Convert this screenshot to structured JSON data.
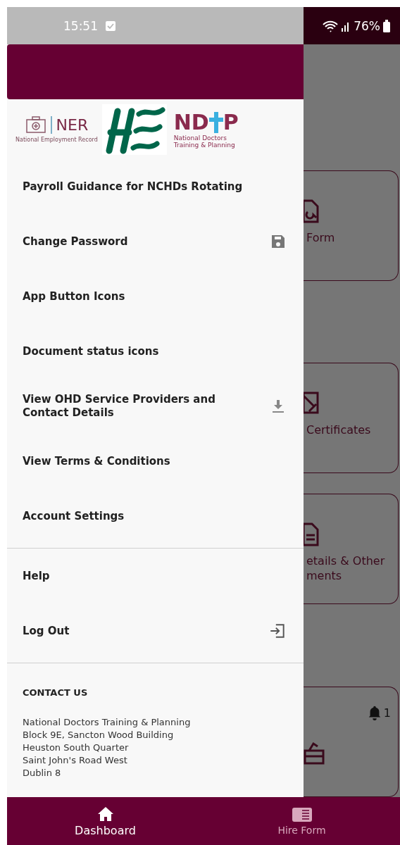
{
  "status_bar": {
    "time": "15:51",
    "battery": "76%"
  },
  "logos": {
    "ner": {
      "title": "NER",
      "subtitle": "National Employment Record"
    },
    "ndtp": {
      "left": "ND",
      "right": "P",
      "subtitle": "National Doctors Training & Planning"
    }
  },
  "menu_groups": [
    {
      "items": [
        {
          "label": "Payroll Guidance for NCHDs Rotating",
          "kind": "plain"
        },
        {
          "label": "Change Password",
          "kind": "save"
        },
        {
          "label": "App Button Icons",
          "kind": "plain"
        },
        {
          "label": "Document status icons",
          "kind": "plain"
        },
        {
          "label": "View OHD Service Providers and Contact Details",
          "kind": "download"
        },
        {
          "label": "View Terms & Conditions",
          "kind": "plain"
        },
        {
          "label": "Account Settings",
          "kind": "plain"
        }
      ]
    },
    {
      "items": [
        {
          "label": "Help",
          "kind": "plain"
        },
        {
          "label": "Log Out",
          "kind": "logout"
        }
      ]
    }
  ],
  "contact": {
    "heading": "CONTACT US",
    "lines": [
      "National Doctors Training & Planning",
      "Block 9E, Sancton Wood Building",
      "Heuston South Quarter",
      "Saint John's Road West",
      "Dublin 8"
    ]
  },
  "background_cards": [
    {
      "lines": [
        "Form"
      ],
      "kind": "search"
    },
    {
      "lines": [
        "Certificates"
      ],
      "kind": "image"
    },
    {
      "lines": [
        "etails & Other",
        "ments"
      ],
      "kind": "document"
    },
    {
      "kind": "bell",
      "badge": "1"
    }
  ],
  "bottom_nav": [
    {
      "label": "Dashboard",
      "kind": "home",
      "selected": true
    },
    {
      "label": "Hire Form",
      "kind": "form",
      "selected": false
    }
  ]
}
